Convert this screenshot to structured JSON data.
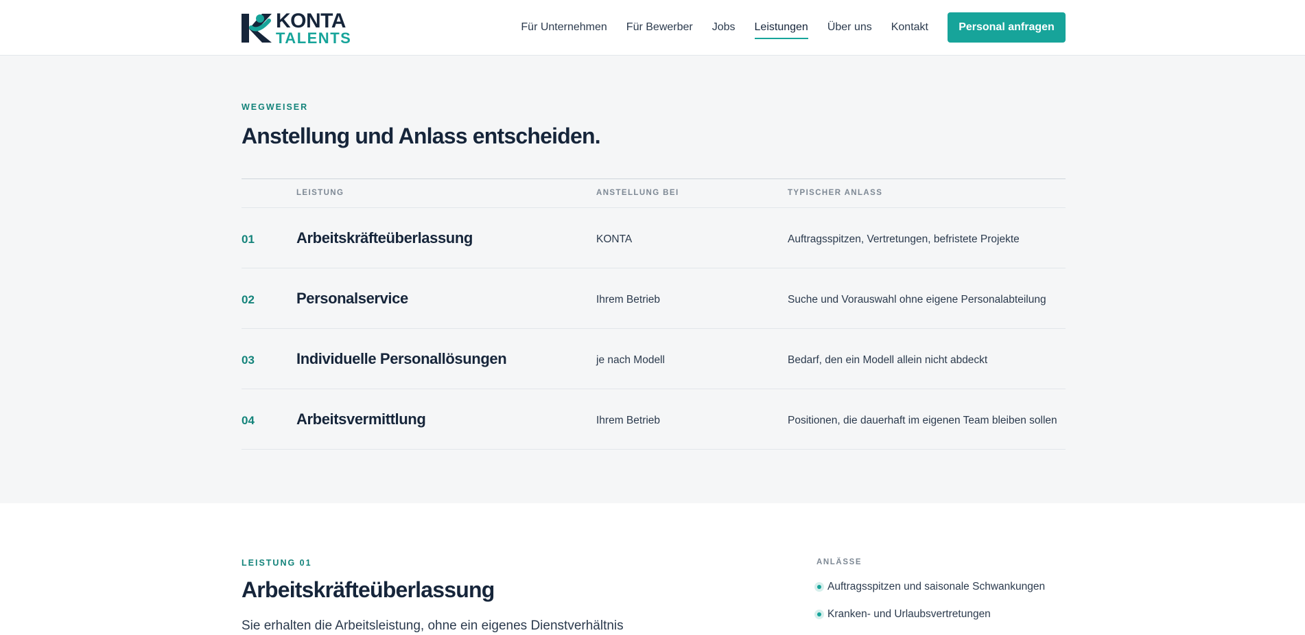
{
  "brand": {
    "name_line1": "KONTA",
    "name_line2": "TALENTS",
    "colors": {
      "accent": "#17a49a",
      "accent_dark": "#13837a",
      "navy": "#16253a"
    }
  },
  "nav": {
    "items": [
      {
        "label": "Für Unternehmen",
        "active": false
      },
      {
        "label": "Für Bewerber",
        "active": false
      },
      {
        "label": "Jobs",
        "active": false
      },
      {
        "label": "Leistungen",
        "active": true
      },
      {
        "label": "Über uns",
        "active": false
      },
      {
        "label": "Kontakt",
        "active": false
      }
    ],
    "cta_label": "Personal anfragen"
  },
  "guide": {
    "eyebrow": "WEGWEISER",
    "title": "Anstellung und Anlass entscheiden.",
    "columns": {
      "service": "LEISTUNG",
      "employment": "ANSTELLUNG BEI",
      "occasion": "TYPISCHER ANLASS"
    },
    "rows": [
      {
        "num": "01",
        "service": "Arbeitskräfteüberlassung",
        "employment": "KONTA",
        "occasion": "Auftragsspitzen, Vertretungen, befristete Projekte"
      },
      {
        "num": "02",
        "service": "Personalservice",
        "employment": "Ihrem Betrieb",
        "occasion": "Suche und Vorauswahl ohne eigene Personalabteilung"
      },
      {
        "num": "03",
        "service": "Individuelle Personallösungen",
        "employment": "je nach Modell",
        "occasion": "Bedarf, den ein Modell allein nicht abdeckt"
      },
      {
        "num": "04",
        "service": "Arbeitsvermittlung",
        "employment": "Ihrem Betrieb",
        "occasion": "Positionen, die dauerhaft im eigenen Team bleiben sollen"
      }
    ]
  },
  "detail": {
    "eyebrow": "LEISTUNG 01",
    "title": "Arbeitskräfteüberlassung",
    "lead": "Sie erhalten die Arbeitsleistung, ohne ein eigenes Dienstverhältnis",
    "aside_title": "ANLÄSSE",
    "occasions": [
      "Auftragsspitzen und saisonale Schwankungen",
      "Kranken- und Urlaubsvertretungen"
    ]
  }
}
